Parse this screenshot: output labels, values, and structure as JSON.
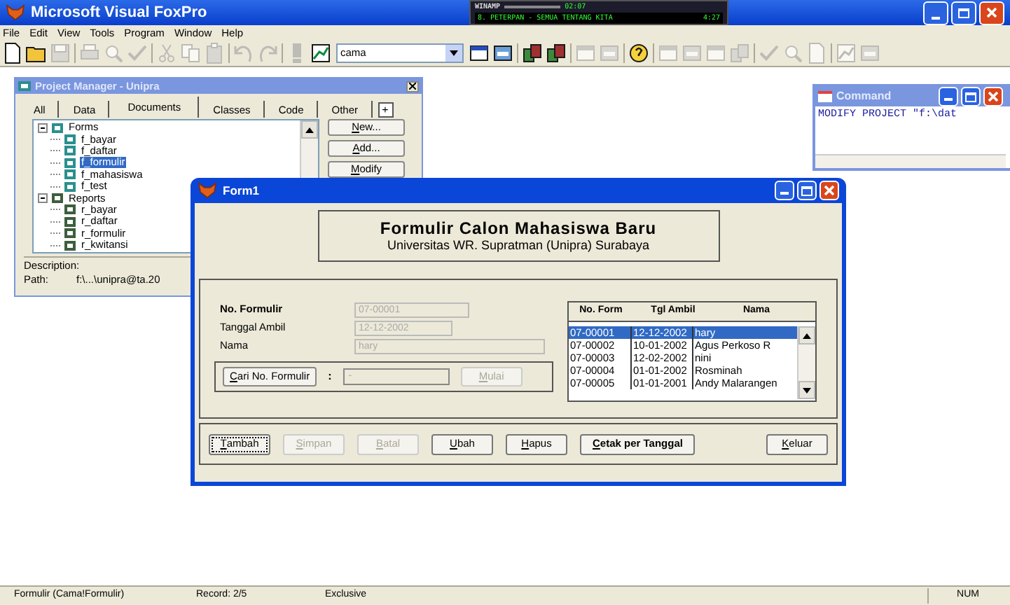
{
  "app": {
    "title": "Microsoft Visual FoxPro"
  },
  "winamp": {
    "title": "WINAMP",
    "time": "02:07",
    "track": "8. PETERPAN - SEMUA TENTANG KITA",
    "length": "4:27"
  },
  "menu": [
    "File",
    "Edit",
    "View",
    "Tools",
    "Program",
    "Window",
    "Help"
  ],
  "toolbar": [
    {
      "kind": "page",
      "disabled": false
    },
    {
      "kind": "folder",
      "disabled": false
    },
    {
      "kind": "disk",
      "disabled": true
    },
    {
      "kind": "separator"
    },
    {
      "kind": "printer",
      "disabled": true
    },
    {
      "kind": "magnifier",
      "disabled": true
    },
    {
      "kind": "check",
      "disabled": true
    },
    {
      "kind": "separator"
    },
    {
      "kind": "scissors",
      "disabled": true
    },
    {
      "kind": "copy",
      "disabled": true
    },
    {
      "kind": "clipboard",
      "disabled": true
    },
    {
      "kind": "separator"
    },
    {
      "kind": "undo",
      "disabled": true
    },
    {
      "kind": "redo",
      "disabled": true
    },
    {
      "kind": "separator"
    },
    {
      "kind": "exclaim",
      "disabled": true
    },
    {
      "kind": "chart",
      "disabled": false
    },
    {
      "kind": "combo",
      "value": "cama"
    },
    {
      "kind": "window",
      "disabled": false
    },
    {
      "kind": "form",
      "disabled": false
    },
    {
      "kind": "separator"
    },
    {
      "kind": "boxes",
      "disabled": false
    },
    {
      "kind": "boxes",
      "disabled": false
    },
    {
      "kind": "separator"
    },
    {
      "kind": "window",
      "disabled": true
    },
    {
      "kind": "form",
      "disabled": true
    },
    {
      "kind": "separator"
    },
    {
      "kind": "question",
      "disabled": false
    },
    {
      "kind": "separator"
    },
    {
      "kind": "window",
      "disabled": true
    },
    {
      "kind": "form",
      "disabled": true
    },
    {
      "kind": "window",
      "disabled": true
    },
    {
      "kind": "boxes",
      "disabled": true
    },
    {
      "kind": "separator"
    },
    {
      "kind": "check",
      "disabled": true
    },
    {
      "kind": "magnifier",
      "disabled": true
    },
    {
      "kind": "page",
      "disabled": true
    },
    {
      "kind": "separator"
    },
    {
      "kind": "chart",
      "disabled": true
    },
    {
      "kind": "form",
      "disabled": true
    }
  ],
  "project_manager": {
    "title": "Project Manager - Unipra",
    "tabs": [
      {
        "label": "All",
        "selected": false
      },
      {
        "label": "Data",
        "selected": false
      },
      {
        "label": "Documents",
        "selected": true
      },
      {
        "label": "Classes",
        "selected": false
      },
      {
        "label": "Code",
        "selected": false
      },
      {
        "label": "Other",
        "selected": false
      }
    ],
    "tab_expander": "+",
    "tree": [
      {
        "label": "Forms",
        "kind": "forms",
        "expanded": true,
        "selected": false,
        "children": [
          {
            "label": "f_bayar",
            "kind": "form",
            "selected": false
          },
          {
            "label": "f_daftar",
            "kind": "form",
            "selected": false
          },
          {
            "label": "f_formulir",
            "kind": "form",
            "selected": true
          },
          {
            "label": "f_mahasiswa",
            "kind": "form",
            "selected": false
          },
          {
            "label": "f_test",
            "kind": "form",
            "selected": false
          }
        ]
      },
      {
        "label": "Reports",
        "kind": "reports",
        "expanded": true,
        "selected": false,
        "children": [
          {
            "label": "r_bayar",
            "kind": "report",
            "selected": false
          },
          {
            "label": "r_daftar",
            "kind": "report",
            "selected": false
          },
          {
            "label": "r_formulir",
            "kind": "report",
            "selected": false
          },
          {
            "label": "r_kwitansi",
            "kind": "report",
            "selected": false
          }
        ]
      }
    ],
    "buttons": [
      "New...",
      "Add...",
      "Modify"
    ],
    "description_label": "Description:",
    "path_label": "Path:",
    "path_value": "f:\\...\\unipra@ta.20"
  },
  "command": {
    "title": "Command",
    "text": "MODIFY PROJECT \"f:\\dat"
  },
  "form": {
    "title": "Form1",
    "heading": "Formulir Calon Mahasiswa Baru",
    "subheading": "Universitas WR. Supratman (Unipra) Surabaya",
    "fields": [
      {
        "label": "No. Formulir",
        "value": "07-00001",
        "bold": true,
        "disabled": true
      },
      {
        "label": "Tanggal Ambil",
        "value": "12-12-2002",
        "bold": false,
        "disabled": true
      },
      {
        "label": "Nama",
        "value": "hary",
        "bold": false,
        "disabled": true
      }
    ],
    "search": {
      "button": "Cari No. Formulir",
      "colon": ":",
      "value": "-",
      "disabled": true,
      "go": "Mulai",
      "go_disabled": true
    },
    "grid": {
      "columns": [
        "No. Form",
        "Tgl Ambil",
        "Nama"
      ],
      "rows": [
        {
          "cells": [
            "07-00001",
            "12-12-2002",
            "hary"
          ],
          "selected": true
        },
        {
          "cells": [
            "07-00002",
            "10-01-2002",
            "Agus Perkoso R"
          ],
          "selected": false
        },
        {
          "cells": [
            "07-00003",
            "12-02-2002",
            "nini"
          ],
          "selected": false
        },
        {
          "cells": [
            "07-00004",
            "01-01-2002",
            "Rosminah"
          ],
          "selected": false
        },
        {
          "cells": [
            "07-00005",
            "01-01-2001",
            "Andy Malarangen"
          ],
          "selected": false
        }
      ]
    },
    "buttons": [
      {
        "label": "Tambah",
        "disabled": false,
        "focused": true,
        "bold": false
      },
      {
        "label": "Simpan",
        "disabled": true,
        "focused": false,
        "bold": false
      },
      {
        "label": "Batal",
        "disabled": true,
        "focused": false,
        "bold": false
      },
      {
        "label": "Ubah",
        "disabled": false,
        "focused": false,
        "bold": false
      },
      {
        "label": "Hapus",
        "disabled": false,
        "focused": false,
        "bold": false
      },
      {
        "label": "Cetak per Tanggal",
        "disabled": false,
        "focused": false,
        "bold": true
      },
      {
        "label": "Keluar",
        "disabled": false,
        "focused": false,
        "bold": false
      }
    ]
  },
  "status_bar": {
    "alias": "Formulir (Cama!Formulir)",
    "record": "Record: 2/5",
    "mode": "Exclusive",
    "num": "NUM"
  }
}
